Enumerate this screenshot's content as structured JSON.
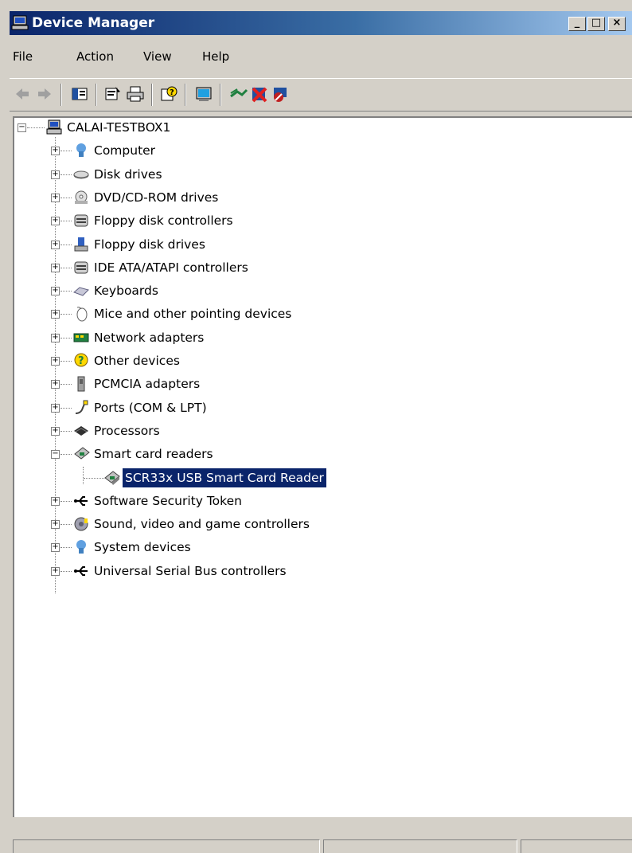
{
  "window": {
    "title": "Device Manager"
  },
  "caption_buttons": {
    "minimize": "_",
    "maximize": "□",
    "close": "×"
  },
  "menu": [
    "File",
    "Action",
    "View",
    "Help"
  ],
  "toolbar": {
    "buttons": [
      "back-icon",
      "forward-icon",
      "show-hide-console-tree-icon",
      "properties-icon",
      "print-icon",
      "help-icon",
      "scan-hardware-icon",
      "update-driver-icon",
      "uninstall-icon",
      "disable-icon"
    ]
  },
  "tree": {
    "root": "CALAI-TESTBOX1",
    "categories": [
      {
        "label": "Computer",
        "icon": "computer-icon",
        "expanded": false
      },
      {
        "label": "Disk drives",
        "icon": "disk-drive-icon",
        "expanded": false
      },
      {
        "label": "DVD/CD-ROM drives",
        "icon": "dvd-drive-icon",
        "expanded": false
      },
      {
        "label": "Floppy disk controllers",
        "icon": "controller-icon",
        "expanded": false
      },
      {
        "label": "Floppy disk drives",
        "icon": "floppy-drive-icon",
        "expanded": false
      },
      {
        "label": "IDE ATA/ATAPI controllers",
        "icon": "controller-icon",
        "expanded": false
      },
      {
        "label": "Keyboards",
        "icon": "keyboard-icon",
        "expanded": false
      },
      {
        "label": "Mice and other pointing devices",
        "icon": "mouse-icon",
        "expanded": false
      },
      {
        "label": "Network adapters",
        "icon": "network-adapter-icon",
        "expanded": false
      },
      {
        "label": "Other devices",
        "icon": "unknown-device-icon",
        "expanded": false
      },
      {
        "label": "PCMCIA adapters",
        "icon": "pcmcia-icon",
        "expanded": false
      },
      {
        "label": "Ports (COM & LPT)",
        "icon": "port-icon",
        "expanded": false
      },
      {
        "label": "Processors",
        "icon": "processor-icon",
        "expanded": false
      },
      {
        "label": "Smart card readers",
        "icon": "smart-card-reader-icon",
        "expanded": true,
        "children": [
          {
            "label": "SCR33x USB Smart Card Reader",
            "icon": "smart-card-reader-icon",
            "selected": true
          }
        ]
      },
      {
        "label": "Software Security Token",
        "icon": "usb-icon",
        "expanded": false
      },
      {
        "label": "Sound, video and game controllers",
        "icon": "sound-icon",
        "expanded": false
      },
      {
        "label": "System devices",
        "icon": "system-device-icon",
        "expanded": false
      },
      {
        "label": "Universal Serial Bus controllers",
        "icon": "usb-icon",
        "expanded": false
      }
    ]
  },
  "colors": {
    "titlebar_start": "#0a246a",
    "titlebar_end": "#a6caf0",
    "selection": "#0a246a",
    "chrome": "#d4d0c8"
  }
}
